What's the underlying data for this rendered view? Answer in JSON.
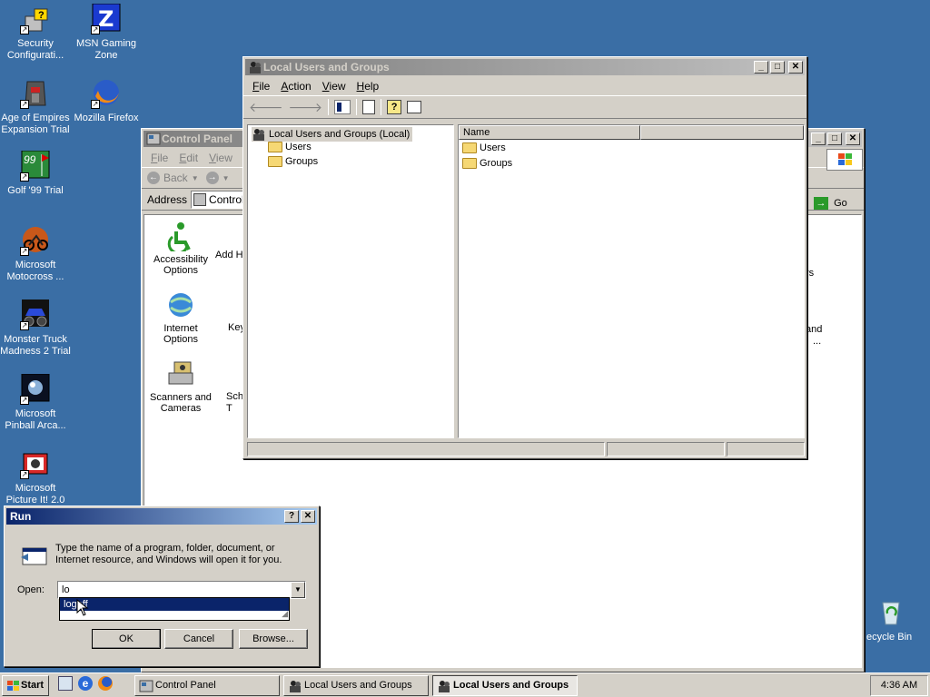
{
  "desktop_icons": [
    {
      "label": "Security Configurati...",
      "icon": "security-config-icon"
    },
    {
      "label": "MSN Gaming Zone",
      "icon": "msn-gaming-zone-icon"
    },
    {
      "label": "Age of Empires Expansion Trial",
      "icon": "age-of-empires-icon"
    },
    {
      "label": "Mozilla Firefox",
      "icon": "firefox-icon"
    },
    {
      "label": "Golf '99 Trial",
      "icon": "golf-icon"
    },
    {
      "label": "Microsoft Motocross ...",
      "icon": "motocross-icon"
    },
    {
      "label": "Monster Truck Madness 2 Trial",
      "icon": "monster-truck-icon"
    },
    {
      "label": "Microsoft Pinball Arca...",
      "icon": "pinball-icon"
    },
    {
      "label": "Microsoft Picture It! 2.0",
      "icon": "picture-it-icon"
    },
    {
      "label": "ecycle Bin",
      "icon": "recycle-bin-icon"
    }
  ],
  "control_panel": {
    "title": "Control Panel",
    "menu": [
      "File",
      "Edit",
      "View"
    ],
    "back_label": "Back",
    "address_label": "Address",
    "address_value": "Control",
    "go_label": "Go",
    "items": [
      {
        "label": "Accessibility Options"
      },
      {
        "label": "Add H"
      },
      {
        "label": "Internet Options"
      },
      {
        "label": "Key"
      },
      {
        "label": "Scanners and Cameras"
      },
      {
        "label": "Sche T"
      }
    ],
    "right_fragments": [
      "rs",
      "and",
      "..."
    ]
  },
  "lusrmgr": {
    "title": "Local Users and Groups",
    "menu": [
      "File",
      "Action",
      "View",
      "Help"
    ],
    "tree_root": "Local Users and Groups (Local)",
    "tree_children": [
      "Users",
      "Groups"
    ],
    "list_header": "Name",
    "list_items": [
      "Users",
      "Groups"
    ]
  },
  "run_dialog": {
    "title": "Run",
    "description": "Type the name of a program, folder, document, or Internet resource, and Windows will open it for you.",
    "open_label": "Open:",
    "input_value": "lo",
    "autocomplete": [
      "logoff"
    ],
    "ok_label": "OK",
    "cancel_label": "Cancel",
    "browse_label": "Browse..."
  },
  "taskbar": {
    "start_label": "Start",
    "tasks": [
      {
        "label": "Control Panel",
        "active": false
      },
      {
        "label": "Local Users and Groups",
        "active": false
      },
      {
        "label": "Local Users and Groups",
        "active": true
      }
    ],
    "clock": "4:36 AM"
  },
  "colors": {
    "desktop": "#3a6ea5",
    "title_active": "#0a246a",
    "title_inactive": "#808080"
  }
}
